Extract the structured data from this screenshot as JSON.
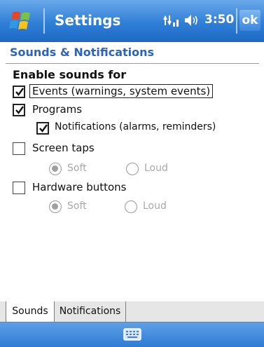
{
  "title_bar": {
    "title": "Settings",
    "time": "3:50",
    "ok_label": "ok",
    "icons": [
      "windows-logo-icon",
      "connectivity-icon",
      "volume-icon"
    ]
  },
  "header": {
    "title": "Sounds & Notifications"
  },
  "content": {
    "section_title": "Enable sounds for",
    "options": [
      {
        "label": "Events (warnings, system events)",
        "checked": true
      },
      {
        "label": "Programs",
        "checked": true
      },
      {
        "label": "Notifications (alarms, reminders)",
        "checked": true
      },
      {
        "label": "Screen taps",
        "checked": false
      },
      {
        "label": "Hardware buttons",
        "checked": false
      }
    ],
    "screen_taps_options": {
      "soft": "Soft",
      "loud": "Loud",
      "selected": "Soft"
    },
    "hardware_buttons_options": {
      "soft": "Soft",
      "loud": "Loud",
      "selected": "Soft"
    }
  },
  "tabs": [
    {
      "label": "Sounds",
      "active": true
    },
    {
      "label": "Notifications",
      "active": false
    }
  ],
  "bottom_bar": {
    "icon": "keyboard-icon"
  },
  "colors": {
    "titlebar": "#2f7fd7",
    "header_text": "#2b64c0",
    "disabled_text": "#a8a8a8"
  }
}
